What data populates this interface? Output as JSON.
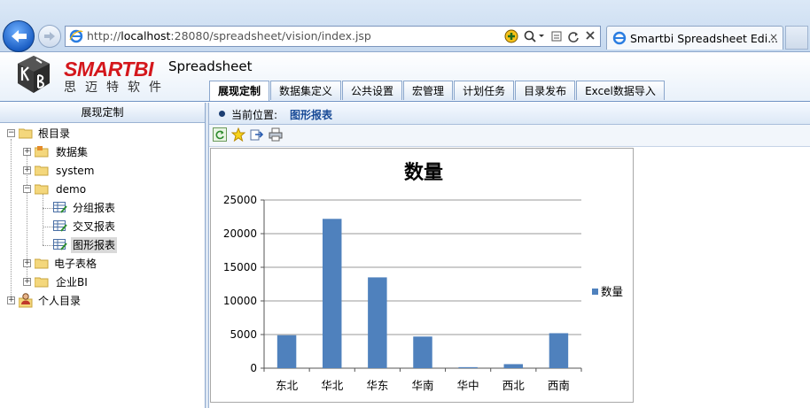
{
  "browser": {
    "url_prefix": "http://",
    "url_host": "localhost",
    "url_rest": ":28080/spreadsheet/vision/index.jsp",
    "tab_title": "Smartbi Spreadsheet Edi...",
    "tab_close": "×"
  },
  "app": {
    "brand": "SMARTBI",
    "brand_cn": "思迈特软件",
    "product": "Spreadsheet",
    "menu": [
      {
        "label": "展现定制",
        "active": true
      },
      {
        "label": "数据集定义"
      },
      {
        "label": "公共设置"
      },
      {
        "label": "宏管理"
      },
      {
        "label": "计划任务"
      },
      {
        "label": "目录发布"
      },
      {
        "label": "Excel数据导入"
      }
    ]
  },
  "left": {
    "title": "展现定制",
    "tree": {
      "root": "根目录",
      "dataset": "数据集",
      "system": "system",
      "demo": "demo",
      "group_report": "分组报表",
      "cross_report": "交叉报表",
      "chart_report": "图形报表",
      "spreadsheet": "电子表格",
      "enterprise_bi": "企业BI",
      "personal": "个人目录"
    }
  },
  "content": {
    "crumb_label": "当前位置:",
    "crumb_value": "图形报表"
  },
  "colors": {
    "bar": "#4f81bd",
    "accent": "#184a96"
  },
  "chart_data": {
    "type": "bar",
    "title": "数量",
    "categories": [
      "东北",
      "华北",
      "华东",
      "华南",
      "华中",
      "西北",
      "西南"
    ],
    "series": [
      {
        "name": "数量",
        "values": [
          4900,
          22200,
          13500,
          4700,
          150,
          600,
          5200
        ]
      }
    ],
    "ylim": [
      0,
      25000
    ],
    "yticks": [
      "0",
      "5000",
      "10000",
      "15000",
      "20000",
      "25000"
    ],
    "grid": true,
    "legend": "right"
  }
}
